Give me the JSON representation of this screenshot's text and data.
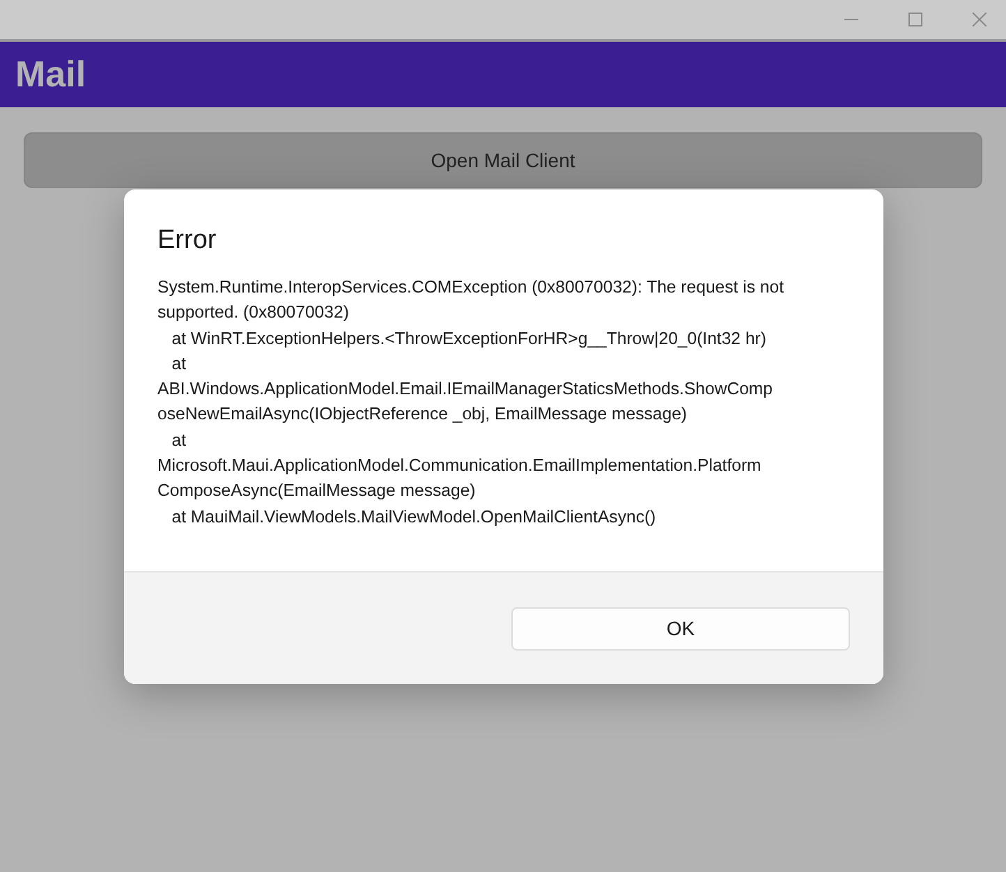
{
  "header": {
    "title": "Mail"
  },
  "open_button": {
    "label": "Open Mail Client"
  },
  "dialog": {
    "title": "Error",
    "message_lines": [
      "System.Runtime.InteropServices.COMException (0x80070032): The request is not",
      "supported. (0x80070032)",
      "   at WinRT.ExceptionHelpers.<ThrowExceptionForHR>g__Throw|20_0(Int32 hr)",
      "   at",
      "ABI.Windows.ApplicationModel.Email.IEmailManagerStaticsMethods.ShowComp",
      "oseNewEmailAsync(IObjectReference _obj, EmailMessage message)",
      "   at",
      "Microsoft.Maui.ApplicationModel.Communication.EmailImplementation.Platform",
      "ComposeAsync(EmailMessage message)",
      "   at MauiMail.ViewModels.MailViewModel.OpenMailClientAsync()"
    ],
    "buttons": [
      "OK"
    ]
  }
}
